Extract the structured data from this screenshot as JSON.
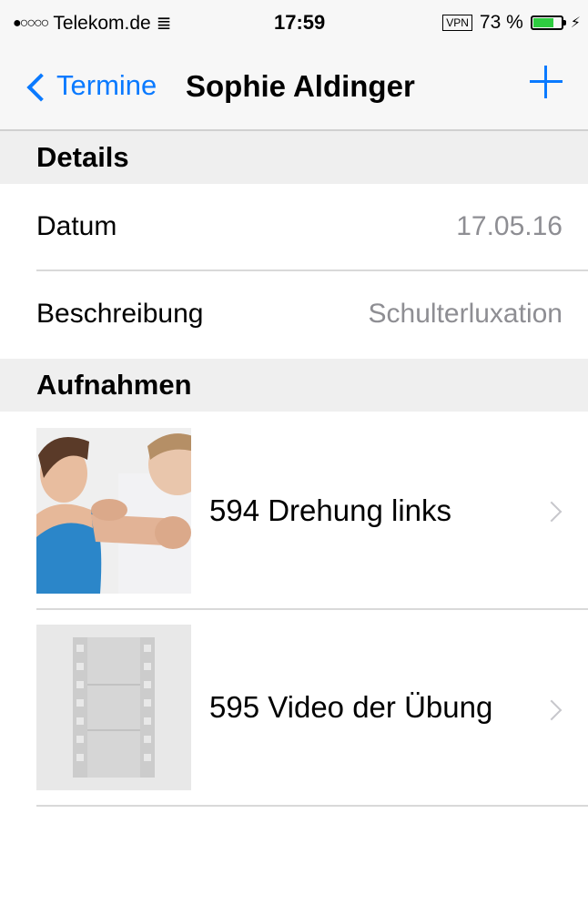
{
  "status_bar": {
    "signal": "●○○○○",
    "carrier": "Telekom.de",
    "time": "17:59",
    "vpn": "VPN",
    "battery_percent": "73 %",
    "battery_level": 0.73
  },
  "nav": {
    "back_label": "Termine",
    "title": "Sophie Aldinger"
  },
  "sections": {
    "details": {
      "header": "Details",
      "rows": [
        {
          "label": "Datum",
          "value": "17.05.16"
        },
        {
          "label": "Beschreibung",
          "value": "Schulterluxation"
        }
      ]
    },
    "recordings": {
      "header": "Aufnahmen",
      "items": [
        {
          "title": "594  Drehung links",
          "thumb_type": "photo"
        },
        {
          "title": "595  Video der Übung",
          "thumb_type": "video-placeholder"
        }
      ]
    }
  },
  "colors": {
    "accent": "#0a7aff",
    "value_text": "#8e8e93",
    "section_bg": "#efefef"
  }
}
